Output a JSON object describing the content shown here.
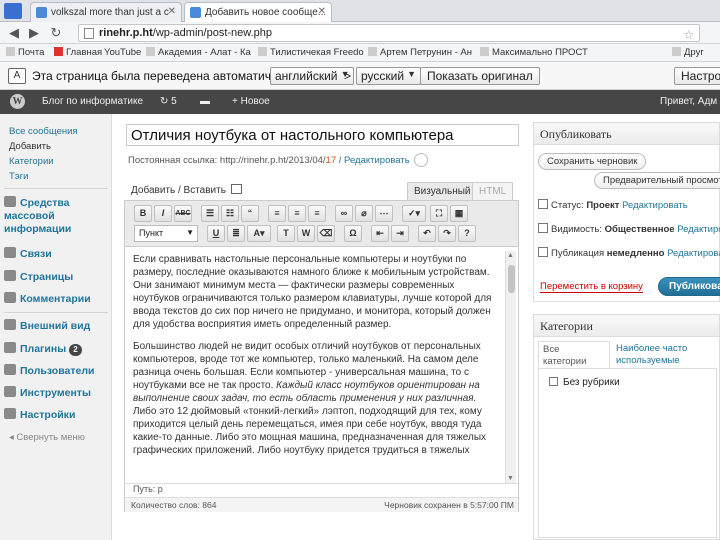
{
  "browser": {
    "tabs": [
      {
        "label": "volkszal more than just a c"
      },
      {
        "label": "Добавить новое сообще..."
      }
    ],
    "url_host": "rinehr.p.ht",
    "url_path": "/wp-admin/post-new.php",
    "bookmarks": [
      "Почта",
      "Главная",
      "YouTube",
      "Академия - Алат - Ка",
      "Тилистичекая Freedo",
      "Артем Петрунин - Ан",
      "Максимально ПРОСТ",
      "Друг"
    ]
  },
  "translate": {
    "message": "Эта страница была переведена автоматически",
    "from_lang": "английский",
    "arrow": ">",
    "to_lang": "русский",
    "show_original": "Показать оригинал",
    "settings": "Настройки"
  },
  "admin_bar": {
    "site_name": "Блог по информатике",
    "updates_count": "5",
    "new_label": "+ Новое",
    "greeting": "Привет, Адм"
  },
  "sidebar": {
    "posts_submenu": [
      "Все сообщения",
      "Добавить",
      "Категории",
      "Тэги"
    ],
    "items": [
      {
        "label": "Средства массовой информации"
      },
      {
        "label": "Связи"
      },
      {
        "label": "Страницы"
      },
      {
        "label": "Комментарии"
      },
      {
        "label": "Внешний вид"
      },
      {
        "label": "Плагины",
        "badge": "2"
      },
      {
        "label": "Пользователи"
      },
      {
        "label": "Инструменты"
      },
      {
        "label": "Настройки"
      }
    ],
    "collapse": "Свернуть меню"
  },
  "editor": {
    "title": "Отличия ноутбука от настольного компьютера",
    "permalink_label": "Постоянная ссылка:",
    "permalink_url": "http://rinehr.p.ht/2013/04/",
    "permalink_slug": "17",
    "permalink_edit": "/ Редактировать",
    "add_media": "Добавить / Вставить",
    "tab_visual": "Визуальный",
    "tab_html": "HTML",
    "format_select": "Пункт",
    "paragraphs": [
      "Если сравнивать настольные персональные компьютеры и ноутбуки по размеру, последние оказываются намного ближе к мобильным устройствам. Они занимают минимум места — фактически размеры современных ноутбуков ограничиваются только размером клавиатуры, лучше которой для ввода текстов до сих пор ничего не придумано, и монитора, который должен для удобства восприятия иметь определенный размер.",
      "Большинство людей не видит особых отличий ноутбуков от персональных компьютеров, вроде тот же компьютер, только маленький. На самом деле разница очень большая. Если компьютер - универсальная машина, то с ноутбуками все не так просто.",
      "Каждый класс ноутбуков ориентирован на выполнение своих задач, то есть область применения у них различная.",
      "Либо это 12 дюймовый «тонкий-легкий» лэптоп, подходящий для тех, кому приходится целый день перемещаться, имея при себе ноутбук, вводя туда какие-то данные. Либо это мощная машина, предназначенная для тяжелых графических приложений. Либо ноутбуку придется трудиться в тяжелых"
    ],
    "path": "Путь: p",
    "word_count": "Количество слов: 864",
    "draft_saved": "Черновик сохранен в 5:57:00 ПМ"
  },
  "publish_box": {
    "title": "Опубликовать",
    "save_draft": "Сохранить черновик",
    "preview": "Предварительный просмотр",
    "status_label": "Статус:",
    "status_value": "Проект",
    "status_edit": "Редактировать",
    "visibility_label": "Видимость:",
    "visibility_value": "Общественное",
    "visibility_edit": "Редактировать",
    "publish_label": "Публикация",
    "publish_value": "немедленно",
    "publish_edit": "Редактировать",
    "trash": "Переместить в корзину",
    "publish_button": "Публиковать"
  },
  "categories_box": {
    "title": "Категории",
    "tab_all": "Все категории",
    "tab_popular": "Наиболее часто используемые",
    "items": [
      "Без рубрики"
    ]
  },
  "colors": {
    "wp_bar": "#464646",
    "link": "#21759b",
    "publish_button": "#2e7fab",
    "trash": "#cc0000"
  }
}
